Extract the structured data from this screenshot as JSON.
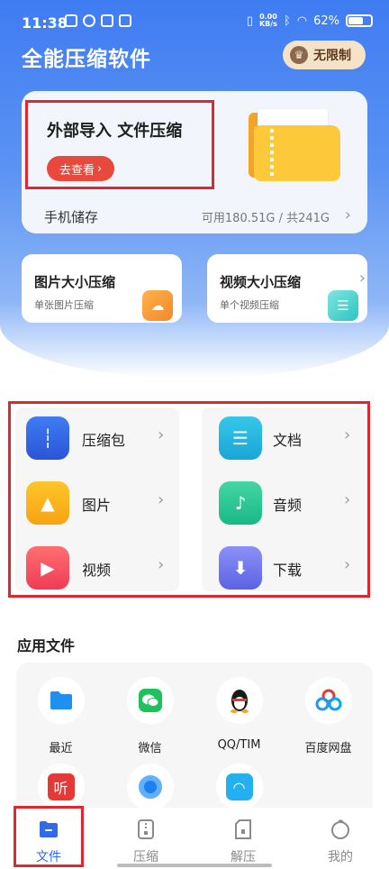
{
  "status_bar": {
    "time": "11:38",
    "net_speed_value": "0.00",
    "net_speed_unit": "KB/s",
    "battery": "62%"
  },
  "header": {
    "title": "全能压缩软件",
    "vip_label": "无限制"
  },
  "main_card": {
    "import_title": "外部导入 文件压缩",
    "go_button": "去查看",
    "storage_label": "手机储存",
    "storage_value": "可用180.51G / 共241G"
  },
  "quick_cards": [
    {
      "title": "图片大小压缩",
      "subtitle": "单张图片压缩",
      "icon": "cloud-image-icon"
    },
    {
      "title": "视频大小压缩",
      "subtitle": "单个视频压缩",
      "icon": "video-doc-icon"
    }
  ],
  "categories_left": [
    {
      "label": "压缩包",
      "icon": "zip-icon"
    },
    {
      "label": "图片",
      "icon": "image-icon"
    },
    {
      "label": "视频",
      "icon": "play-icon"
    }
  ],
  "categories_right": [
    {
      "label": "文档",
      "icon": "document-icon"
    },
    {
      "label": "音频",
      "icon": "music-note-icon"
    },
    {
      "label": "下载",
      "icon": "download-icon"
    }
  ],
  "apps_section": {
    "title": "应用文件",
    "items": [
      {
        "label": "最近",
        "icon": "folder-icon"
      },
      {
        "label": "微信",
        "icon": "wechat-icon"
      },
      {
        "label": "QQ/TIM",
        "icon": "qq-penguin-icon"
      },
      {
        "label": "百度网盘",
        "icon": "baidu-netdisk-icon"
      }
    ],
    "partial_icons": [
      "听",
      "",
      ""
    ]
  },
  "tabbar": [
    {
      "label": "文件",
      "icon": "file-folder-icon",
      "active": true
    },
    {
      "label": "压缩",
      "icon": "compress-icon",
      "active": false
    },
    {
      "label": "解压",
      "icon": "extract-icon",
      "active": false
    },
    {
      "label": "我的",
      "icon": "profile-icon",
      "active": false
    }
  ],
  "colors": {
    "primary": "#2f6bea",
    "highlight_red": "#e0262e",
    "button_red": "#e8493c"
  }
}
